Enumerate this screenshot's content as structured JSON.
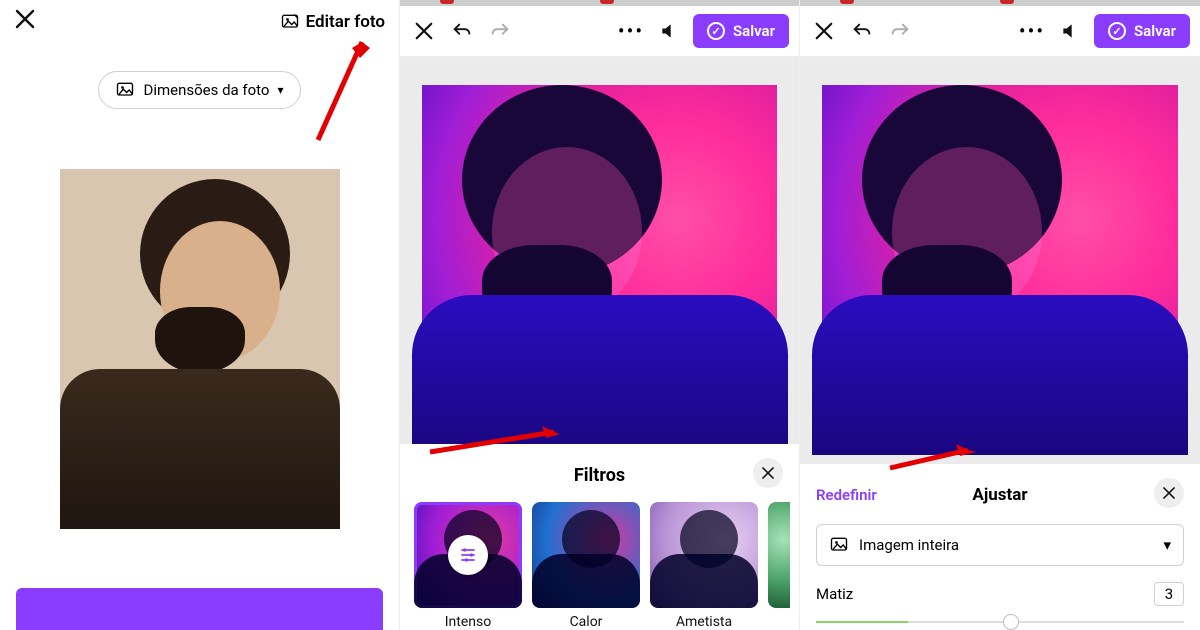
{
  "col1": {
    "edit_label": "Editar foto",
    "dimensions_label": "Dimensões da foto"
  },
  "editor": {
    "save_label": "Salvar"
  },
  "filters": {
    "title": "Filtros",
    "items": [
      {
        "label": "Intenso"
      },
      {
        "label": "Calor"
      },
      {
        "label": "Ametista"
      }
    ]
  },
  "adjust": {
    "reset_label": "Redefinir",
    "title": "Ajustar",
    "scope_label": "Imagem inteira",
    "slider_label": "Matiz",
    "slider_value": "3"
  }
}
